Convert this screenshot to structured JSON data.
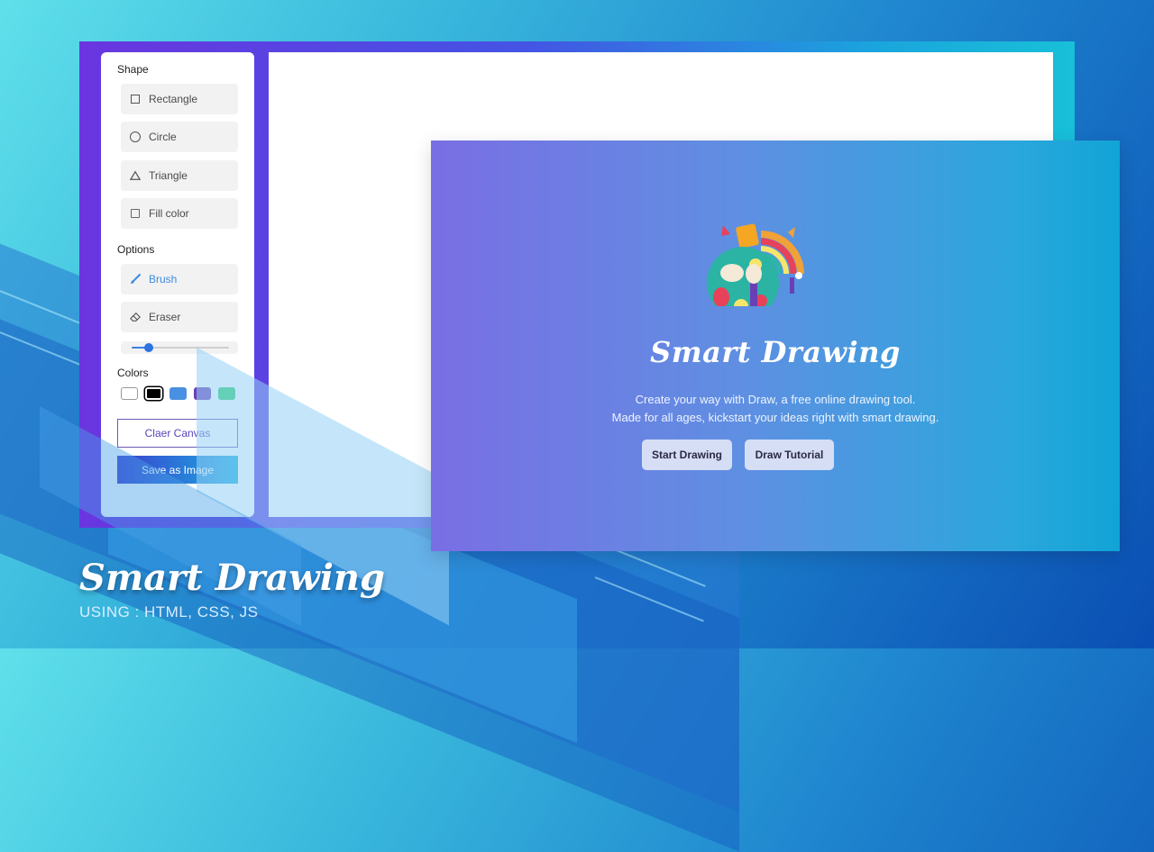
{
  "sidebar": {
    "shape_title": "Shape",
    "shapes": [
      {
        "label": "Rectangle",
        "icon": "rectangle-icon"
      },
      {
        "label": "Circle",
        "icon": "circle-icon"
      },
      {
        "label": "Triangle",
        "icon": "triangle-icon"
      },
      {
        "label": "Fill color",
        "icon": "checkbox-icon"
      }
    ],
    "options_title": "Options",
    "options": [
      {
        "label": "Brush",
        "icon": "brush-icon",
        "active": true
      },
      {
        "label": "Eraser",
        "icon": "eraser-icon",
        "active": false
      }
    ],
    "brush_size_fraction": 0.18,
    "colors_title": "Colors",
    "colors": [
      "#ffffff",
      "#000000",
      "#4a90e2",
      "#6a3fb5",
      "#2ecc71"
    ],
    "selected_color": "#000000",
    "clear_label": "Claer Canvas",
    "save_label": "Save as Image"
  },
  "overlay": {
    "title": "Smart Drawing",
    "line1": "Create your way with Draw, a free online drawing tool.",
    "line2": "Made for all ages, kickstart your ideas right with smart drawing.",
    "start_label": "Start Drawing",
    "tutorial_label": "Draw Tutorial",
    "logo_icon": "paint-palette-icon"
  },
  "caption": {
    "title": "Smart Drawing",
    "subtitle": "USING : HTML, CSS, JS"
  },
  "colors": {
    "accent": "#3d8ce0",
    "frame_start": "#6a35e0",
    "frame_end": "#18c0d8"
  }
}
